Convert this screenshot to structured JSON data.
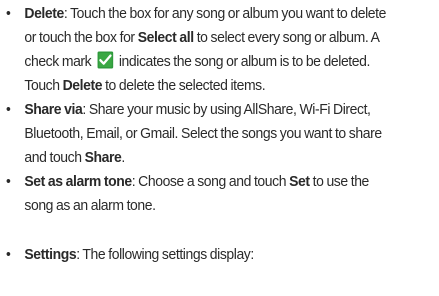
{
  "items": {
    "delete": {
      "bullet": "•",
      "term": "Delete",
      "sep": ": ",
      "line1_text": "Touch the box for any song or album you want to delete",
      "line2_pre": "or touch the box for ",
      "line2_bold": "Select all",
      "line2_post": " to select every song or album. A",
      "line3_pre": "check mark",
      "line3_post": "indicates the song or album is to be deleted.",
      "line4_pre": "Touch ",
      "line4_bold": "Delete",
      "line4_post": " to delete the selected items.",
      "icon": "checkbox-checked-icon",
      "icon_color": "#2f9a3c"
    },
    "share": {
      "bullet": "•",
      "term": "Share via",
      "sep": ": ",
      "line1_text": "Share your music by using AllShare, Wi-Fi Direct,",
      "line2_text": "Bluetooth, Email, or Gmail. Select the songs you want to share",
      "line3_pre": "and touch ",
      "line3_bold": "Share",
      "line3_post": "."
    },
    "alarm": {
      "bullet": "•",
      "term": "Set as alarm tone",
      "sep": ": ",
      "line1_pre": "Choose a song and touch ",
      "line1_bold": "Set",
      "line1_post": " to use the",
      "line2_text": "song as an alarm tone."
    },
    "settings": {
      "bullet": "•",
      "term": "Settings",
      "sep": ": ",
      "line1_text": "The following settings display:"
    }
  }
}
